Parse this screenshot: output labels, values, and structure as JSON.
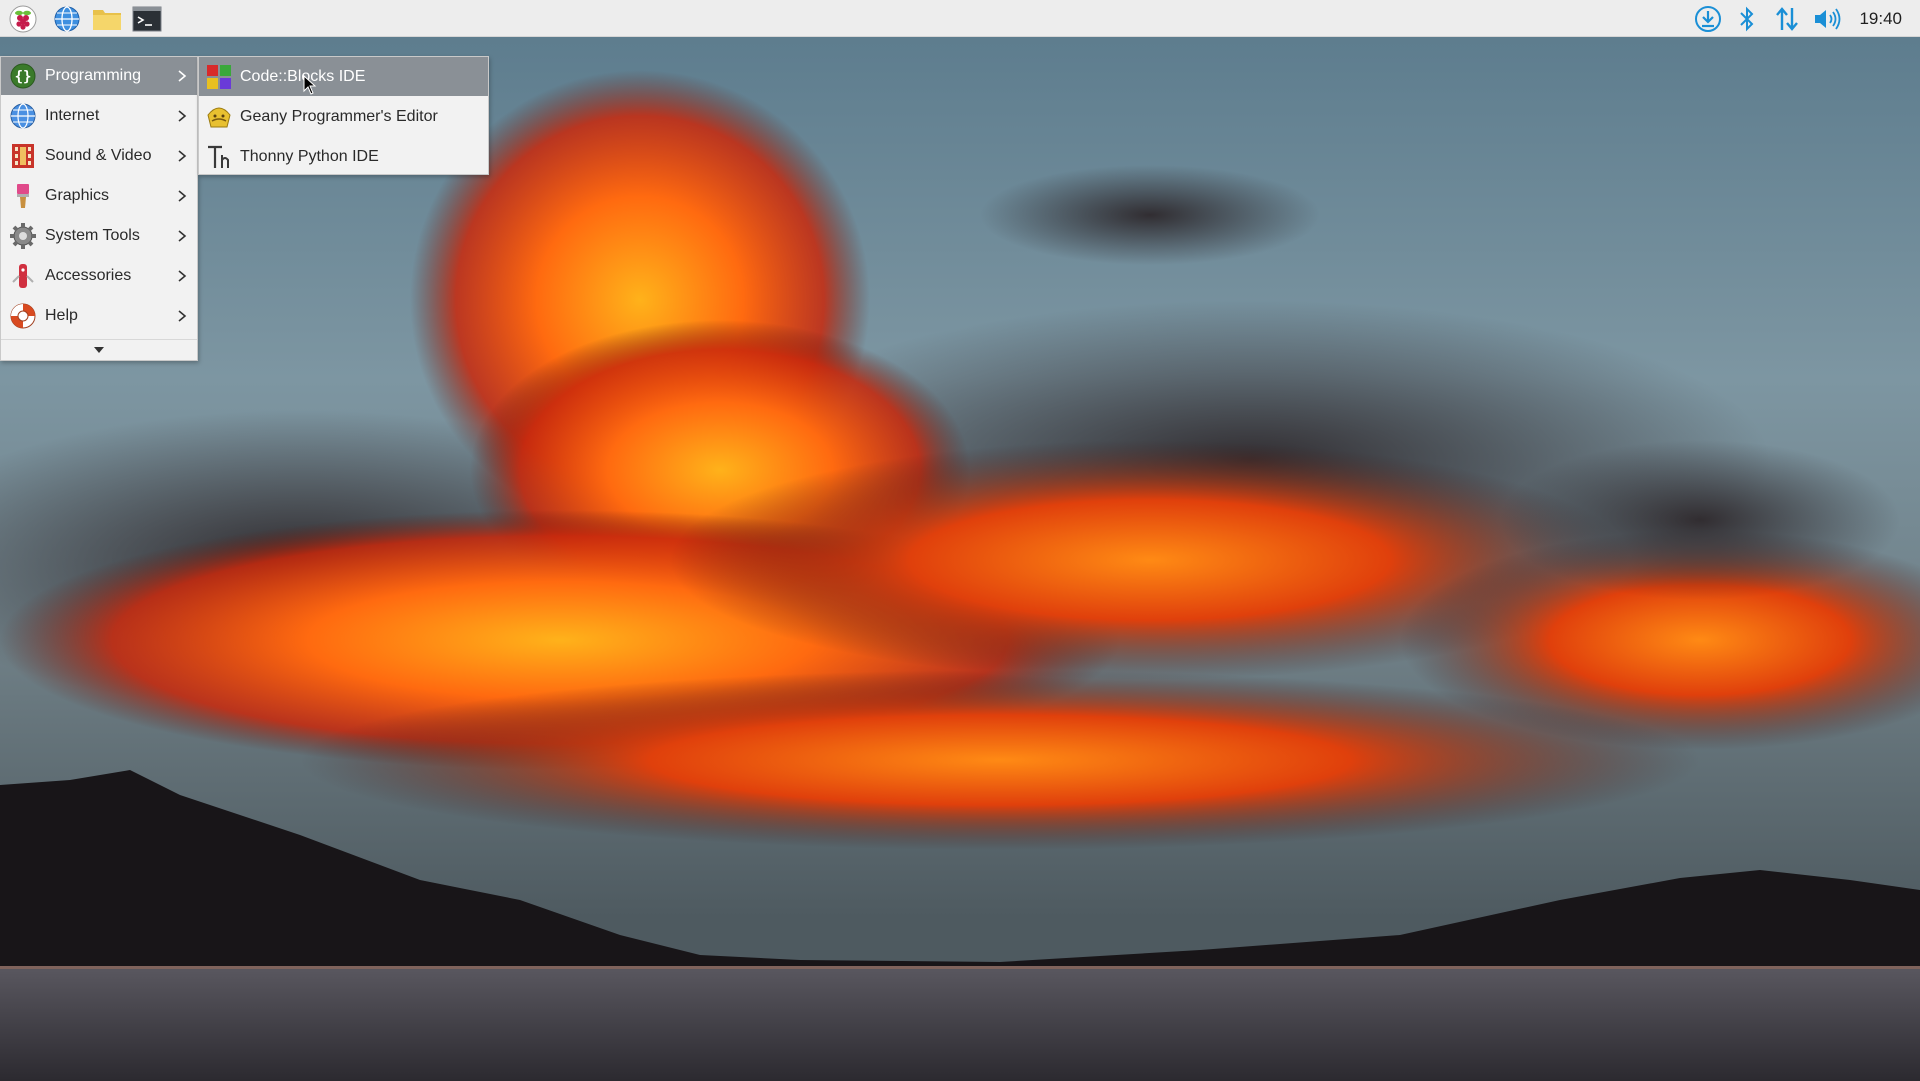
{
  "taskbar": {
    "launchers": [
      {
        "icon": "raspberry-pi-icon",
        "label": "Applications Menu"
      },
      {
        "icon": "web-browser-icon",
        "label": "Web Browser"
      },
      {
        "icon": "file-manager-icon",
        "label": "File Manager"
      },
      {
        "icon": "terminal-icon",
        "label": "Terminal"
      }
    ],
    "tray": [
      {
        "icon": "updates-download-icon"
      },
      {
        "icon": "bluetooth-icon"
      },
      {
        "icon": "network-icon"
      },
      {
        "icon": "volume-icon"
      }
    ],
    "clock": "19:40"
  },
  "main_menu": {
    "items": [
      {
        "label": "Programming",
        "icon": "programming-icon",
        "active": true
      },
      {
        "label": "Internet",
        "icon": "internet-icon",
        "active": false
      },
      {
        "label": "Sound & Video",
        "icon": "sound-video-icon",
        "active": false
      },
      {
        "label": "Graphics",
        "icon": "graphics-icon",
        "active": false
      },
      {
        "label": "System Tools",
        "icon": "system-tools-icon",
        "active": false
      },
      {
        "label": "Accessories",
        "icon": "accessories-icon",
        "active": false
      },
      {
        "label": "Help",
        "icon": "help-icon",
        "active": false
      }
    ],
    "more_indicator": "scroll-down-icon"
  },
  "sub_menu": {
    "parent": "Programming",
    "items": [
      {
        "label": "Code::Blocks IDE",
        "icon": "codeblocks-icon",
        "active": true
      },
      {
        "label": "Geany Programmer's Editor",
        "icon": "geany-icon",
        "active": false
      },
      {
        "label": "Thonny Python IDE",
        "icon": "thonny-icon",
        "active": false
      }
    ]
  },
  "colors": {
    "taskbar_bg": "#ededed",
    "menu_bg": "#f2f2f2",
    "menu_highlight": "#8a9096",
    "tray_accent": "#1a8fd6"
  }
}
